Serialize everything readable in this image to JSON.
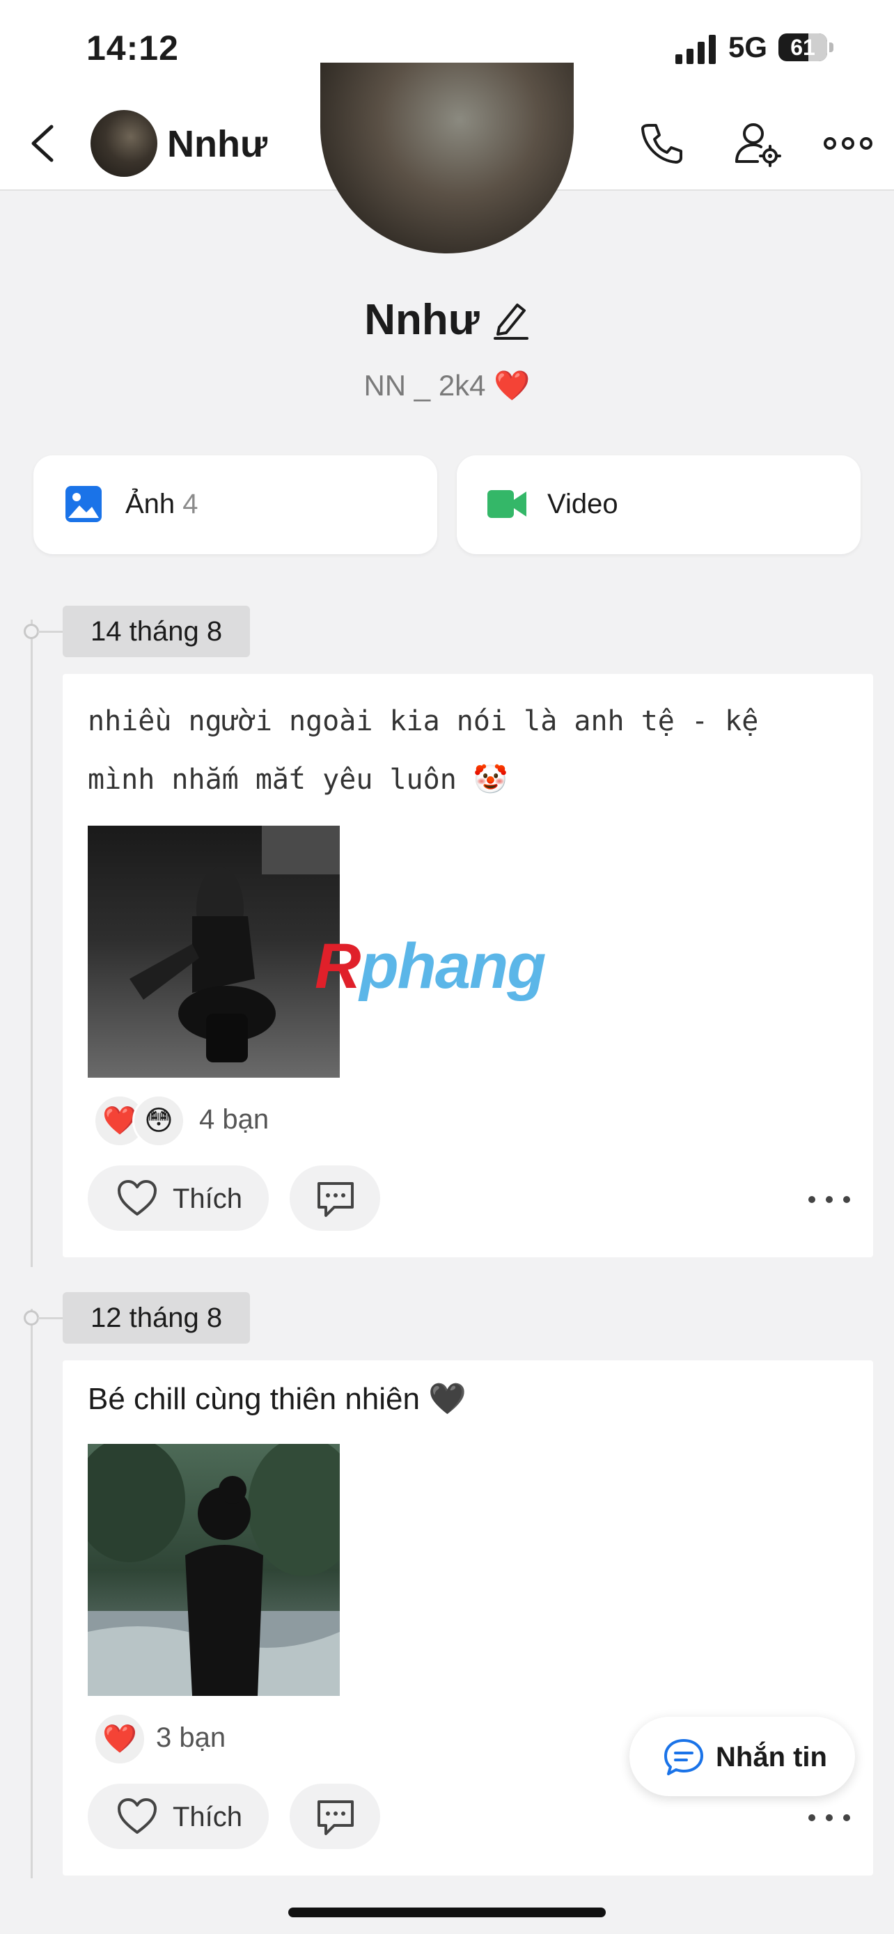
{
  "status_bar": {
    "time": "14:12",
    "network": "5G",
    "battery": "61",
    "battery_level": 0.61
  },
  "header": {
    "name": "Nnhư",
    "icons": [
      "back-icon",
      "phone-icon",
      "user-settings-icon",
      "more-icon"
    ]
  },
  "profile": {
    "name": "Nnhư",
    "bio": "NN _ 2k4 ❤️"
  },
  "tiles": {
    "photos": {
      "label": "Ảnh",
      "count": "4",
      "icon": "image-icon",
      "color": "#1a73e8"
    },
    "video": {
      "label": "Video",
      "icon": "video-icon",
      "color": "#34b768"
    }
  },
  "posts": [
    {
      "date": "14 tháng 8",
      "text_line1": "nhiều người ngoài kia nói là anh tệ - kệ",
      "text_line2": "mình nhắm mắt yêu luôn 🤡",
      "reactions": [
        "❤️",
        "😳"
      ],
      "reaction_count": "4 bạn",
      "like_label": "Thích"
    },
    {
      "date": "12 tháng 8",
      "text": "Bé chill cùng thiên nhiên 🖤",
      "reactions": [
        "❤️"
      ],
      "reaction_count": "3 bạn",
      "like_label": "Thích"
    }
  ],
  "watermark": {
    "first": "R",
    "rest": "phang"
  },
  "fab": {
    "label": "Nhắn tin"
  },
  "colors": {
    "background": "#f2f2f3",
    "accent": "#1a73e8",
    "green": "#34b768",
    "heart": "#e0202a"
  }
}
